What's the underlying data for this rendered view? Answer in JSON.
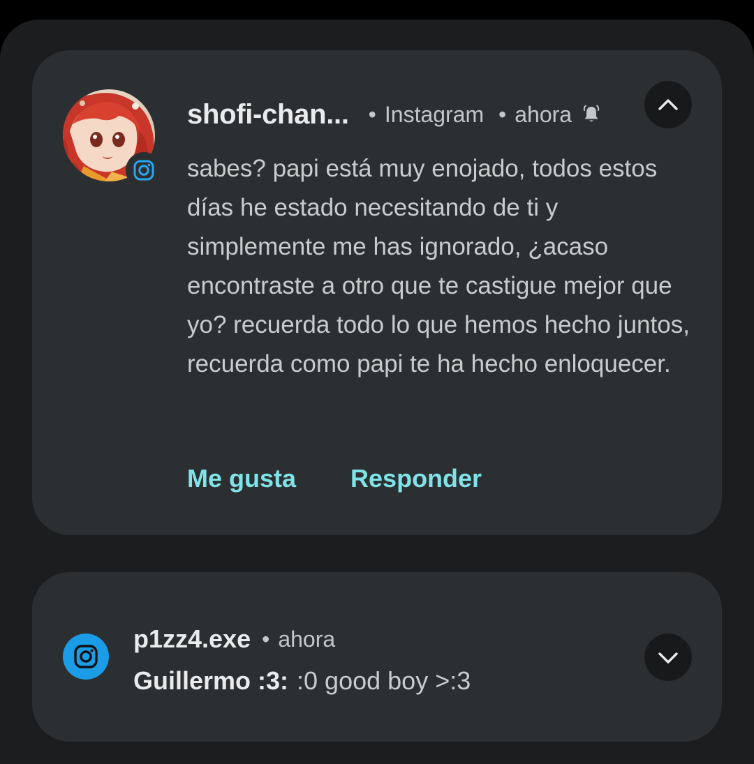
{
  "notifications": [
    {
      "sender": "shofi-chan...",
      "app_name": "Instagram",
      "time": "ahora",
      "avatar_icon": "anime-avatar",
      "app_badge_icon": "instagram-icon",
      "status_icon": "bell-icon",
      "collapse_icon": "chevron-up-icon",
      "message": "sabes? papi está muy enojado, todos estos días he estado necesitando de ti y simplemente me has ignorado, ¿acaso encontraste a otro que te castigue mejor que yo? recuerda todo lo que hemos hecho juntos, recuerda como papi te ha hecho enloquecer.",
      "actions": {
        "like": "Me gusta",
        "reply": "Responder"
      },
      "action_color": "#7fe3e8"
    },
    {
      "sender": "p1zz4.exe",
      "time": "ahora",
      "app_icon": "instagram-icon",
      "expand_icon": "chevron-down-icon",
      "preview_author": "Guillermo :3:",
      "preview_text": ":0 good boy >:3",
      "icon_color": "#1a9ce6"
    }
  ],
  "separator": "•"
}
